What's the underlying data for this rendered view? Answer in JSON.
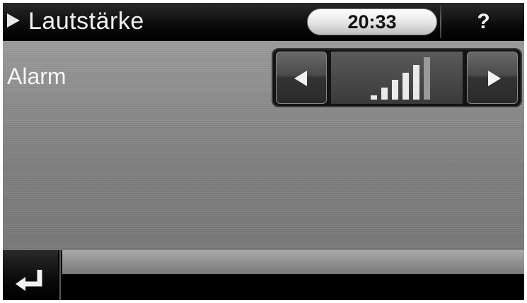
{
  "header": {
    "title": "Lautstärke",
    "title_arrow_icon": "play-arrow-icon",
    "time": "20:33",
    "help_label": "?"
  },
  "settings": {
    "alarm": {
      "label": "Alarm",
      "decrease_icon": "arrow-left-icon",
      "increase_icon": "arrow-right-icon",
      "volume_icon": "volume-level-bars-icon",
      "level": 5,
      "max_level": 6
    }
  },
  "footer": {
    "back_icon": "return-arrow-icon"
  },
  "colors": {
    "header_bg": "#000000",
    "panel_bg": "#8a8a8a",
    "text": "#f2f2f2",
    "clock_bg": "#eeeeee"
  }
}
